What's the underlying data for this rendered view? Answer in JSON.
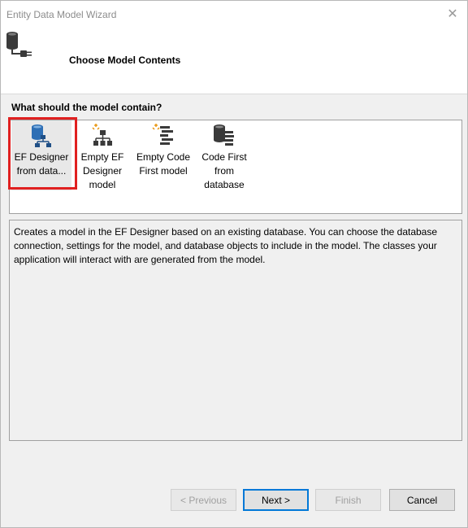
{
  "window": {
    "title": "Entity Data Model Wizard",
    "close_glyph": "✕"
  },
  "header": {
    "icon": "database-connection-icon",
    "title": "Choose Model Contents"
  },
  "prompt": "What should the model contain?",
  "options": [
    {
      "label": "EF Designer\nfrom data...",
      "icon": "ef-designer-database-icon",
      "selected": true
    },
    {
      "label": "Empty EF\nDesigner\nmodel",
      "icon": "empty-ef-designer-icon",
      "selected": false
    },
    {
      "label": "Empty Code\nFirst model",
      "icon": "empty-code-first-icon",
      "selected": false
    },
    {
      "label": "Code First\nfrom\ndatabase",
      "icon": "code-first-database-icon",
      "selected": false
    }
  ],
  "description": "Creates a model in the EF Designer based on an existing database. You can choose the database connection, settings for the model, and database objects to include in the model. The classes your application will interact with are generated from the model.",
  "buttons": {
    "previous": "< Previous",
    "next": "Next >",
    "finish": "Finish",
    "cancel": "Cancel"
  },
  "colors": {
    "highlight_box": "#e02020",
    "icon_blue": "#2e6fb5",
    "icon_dark": "#3a3a3a",
    "icon_orange": "#e8930c",
    "default_button_border": "#0078d7"
  }
}
